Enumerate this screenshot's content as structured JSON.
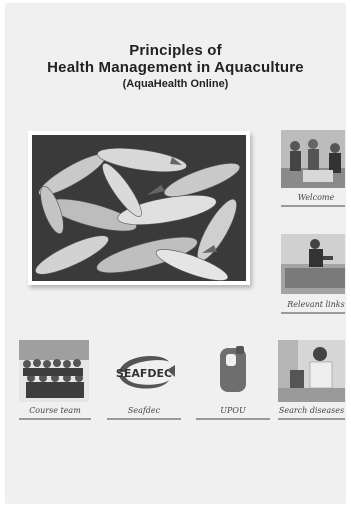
{
  "header": {
    "line1": "Principles of",
    "line2": "Health Management in Aquaculture",
    "line3": "(AquaHealth Online)"
  },
  "nav": {
    "welcome": "Welcome",
    "relevant_links": "Relevant links",
    "course_team": "Course team",
    "seafdec": "Seafdec",
    "upou": "UPOU",
    "search_diseases": "Search diseases"
  },
  "logos": {
    "seafdec_text": "SEAFDEC"
  }
}
